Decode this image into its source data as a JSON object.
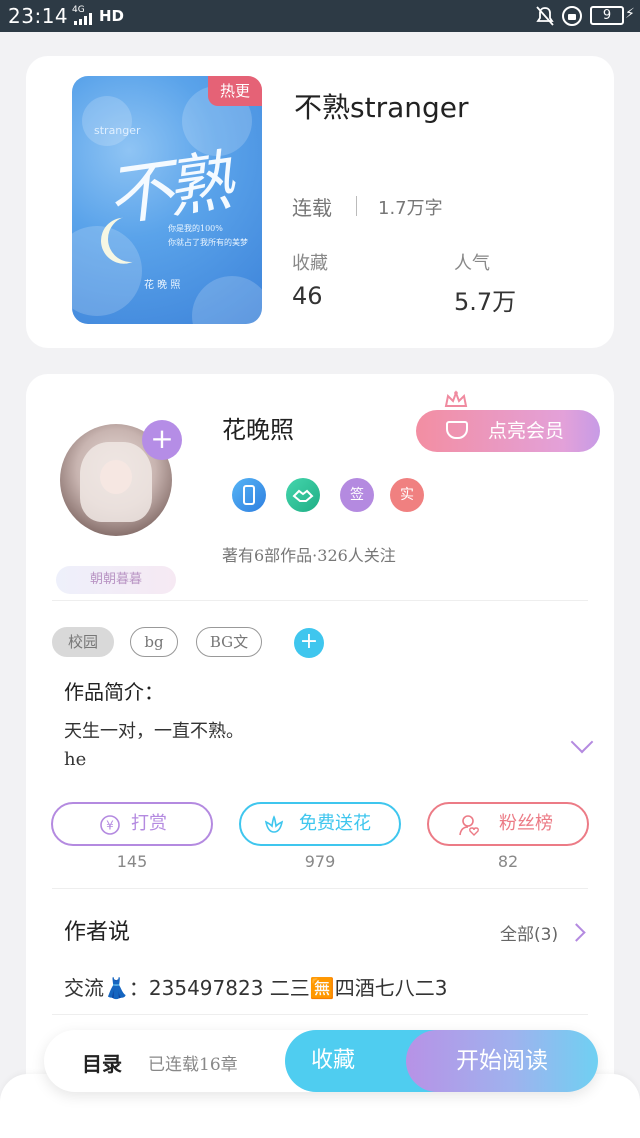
{
  "status_bar": {
    "time": "23:14",
    "network": "4G",
    "hd": "HD",
    "battery": "9"
  },
  "book": {
    "hot_badge": "热更",
    "title": "不熟stranger",
    "status": "连载",
    "word_count": "1.7万字",
    "stats": [
      {
        "label": "收藏",
        "value": "46"
      },
      {
        "label": "人气",
        "value": "5.7万"
      }
    ],
    "cover": {
      "en_text": "stranger",
      "title_text": "不熟",
      "subtitle_lines": [
        "你是我的100%",
        "你就占了我所有的美梦"
      ],
      "author_text": "花 晚 照"
    }
  },
  "author": {
    "name": "花晚照",
    "vip_label": "点亮会员",
    "fan_badge": "朝朝暮暮",
    "badges": [
      {
        "name": "phone-badge-icon",
        "text": "",
        "color": "#3a8fe8"
      },
      {
        "name": "handshake-badge-icon",
        "text": "",
        "color": "#2ec79a"
      },
      {
        "name": "sign-badge-icon",
        "text": "签",
        "color": "#b48ae0"
      },
      {
        "name": "verified-badge-icon",
        "text": "实",
        "color": "#f08080"
      }
    ],
    "meta": "著有6部作品·326人关注"
  },
  "tags": [
    "校园",
    "bg",
    "BG文"
  ],
  "intro": {
    "title": "作品简介：",
    "line1": "天生一对，一直不熟。",
    "line2": "he"
  },
  "actions": [
    {
      "label": "打赏",
      "count": "145",
      "color": "#b48ae0"
    },
    {
      "label": "免费送花",
      "count": "979",
      "color": "#3fc6ee"
    },
    {
      "label": "粉丝榜",
      "count": "82",
      "color": "#ec7b86"
    }
  ],
  "author_says": {
    "title": "作者说",
    "all_label": "全部(3)",
    "text_prefix": "交流",
    "dress_emoji": "👗",
    "text_body": "：235497823 二三",
    "text_symbol": "🈚",
    "text_suffix": "四酒七八二3"
  },
  "bottom_bar": {
    "toc": "目录",
    "chapters": "已连载16章",
    "collect": "收藏",
    "read": "开始阅读"
  },
  "colors": {
    "accent_purple": "#b48ae0",
    "accent_cyan": "#3fc6ee",
    "hot_red": "#e56276"
  }
}
